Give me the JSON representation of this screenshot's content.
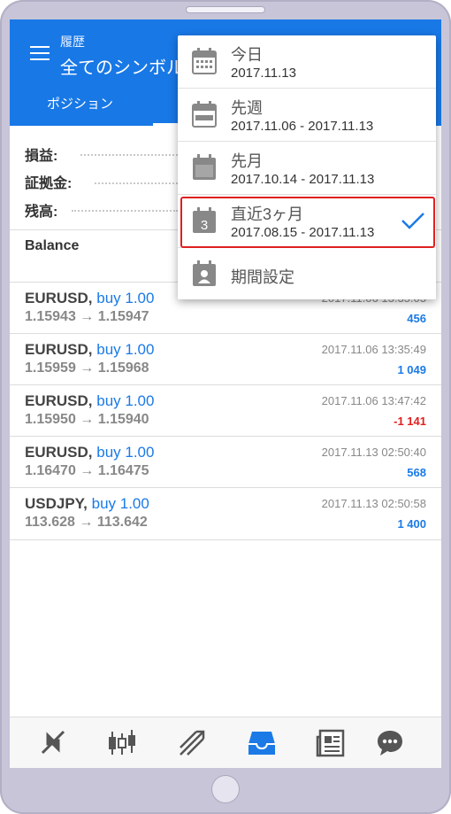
{
  "header": {
    "subtitle": "履歴",
    "title": "全てのシンボル"
  },
  "tabs": [
    {
      "label": "ポジション"
    }
  ],
  "summary": {
    "profit_label": "損益:",
    "margin_label": "証拠金:",
    "balance_label": "残高:"
  },
  "balance_title": "Balance",
  "deals": [
    {
      "symbol": "EURUSD,",
      "action": "buy 1.00",
      "prices": "1.15943 → 1.15947",
      "time": "2017.11.06 13:35:03",
      "profit": "456",
      "negative": false
    },
    {
      "symbol": "EURUSD,",
      "action": "buy 1.00",
      "prices": "1.15959 → 1.15968",
      "time": "2017.11.06 13:35:49",
      "profit": "1 049",
      "negative": false
    },
    {
      "symbol": "EURUSD,",
      "action": "buy 1.00",
      "prices": "1.15950 → 1.15940",
      "time": "2017.11.06 13:47:42",
      "profit": "-1 141",
      "negative": true
    },
    {
      "symbol": "EURUSD,",
      "action": "buy 1.00",
      "prices": "1.16470 → 1.16475",
      "time": "2017.11.13 02:50:40",
      "profit": "568",
      "negative": false
    },
    {
      "symbol": "USDJPY,",
      "action": "buy 1.00",
      "prices": "113.628 → 113.642",
      "time": "2017.11.13 02:50:58",
      "profit": "1 400",
      "negative": false
    }
  ],
  "period_menu": {
    "items": [
      {
        "label": "今日",
        "range": "2017.11.13",
        "icon": "calendar-day-icon"
      },
      {
        "label": "先週",
        "range": "2017.11.06 - 2017.11.13",
        "icon": "calendar-week-icon"
      },
      {
        "label": "先月",
        "range": "2017.10.14 - 2017.11.13",
        "icon": "calendar-month-icon"
      },
      {
        "label": "直近3ヶ月",
        "range": "2017.08.15 - 2017.11.13",
        "icon": "calendar-3-icon",
        "calendar_number": "3",
        "selected": true
      },
      {
        "label": "期間設定",
        "icon": "calendar-custom-icon"
      }
    ]
  },
  "bottom_nav": [
    "quotes-icon",
    "chart-candles-icon",
    "trade-icon",
    "history-inbox-icon",
    "news-icon",
    "chat-icon"
  ],
  "colors": {
    "accent": "#1878e6",
    "negative": "#e02020",
    "selection_outline": "#e02020"
  }
}
